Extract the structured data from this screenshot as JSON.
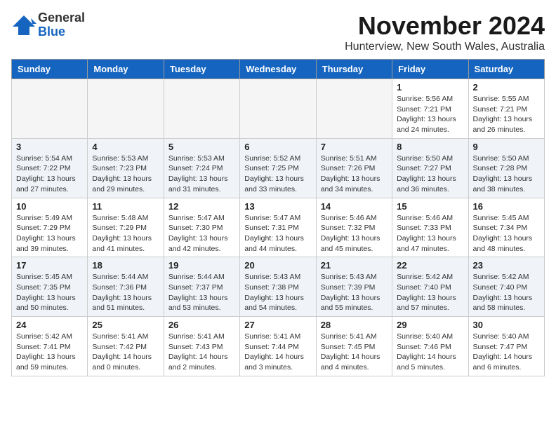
{
  "header": {
    "logo_general": "General",
    "logo_blue": "Blue",
    "month_title": "November 2024",
    "location": "Hunterview, New South Wales, Australia"
  },
  "days_of_week": [
    "Sunday",
    "Monday",
    "Tuesday",
    "Wednesday",
    "Thursday",
    "Friday",
    "Saturday"
  ],
  "weeks": [
    [
      {
        "day": "",
        "info": ""
      },
      {
        "day": "",
        "info": ""
      },
      {
        "day": "",
        "info": ""
      },
      {
        "day": "",
        "info": ""
      },
      {
        "day": "",
        "info": ""
      },
      {
        "day": "1",
        "info": "Sunrise: 5:56 AM\nSunset: 7:21 PM\nDaylight: 13 hours\nand 24 minutes."
      },
      {
        "day": "2",
        "info": "Sunrise: 5:55 AM\nSunset: 7:21 PM\nDaylight: 13 hours\nand 26 minutes."
      }
    ],
    [
      {
        "day": "3",
        "info": "Sunrise: 5:54 AM\nSunset: 7:22 PM\nDaylight: 13 hours\nand 27 minutes."
      },
      {
        "day": "4",
        "info": "Sunrise: 5:53 AM\nSunset: 7:23 PM\nDaylight: 13 hours\nand 29 minutes."
      },
      {
        "day": "5",
        "info": "Sunrise: 5:53 AM\nSunset: 7:24 PM\nDaylight: 13 hours\nand 31 minutes."
      },
      {
        "day": "6",
        "info": "Sunrise: 5:52 AM\nSunset: 7:25 PM\nDaylight: 13 hours\nand 33 minutes."
      },
      {
        "day": "7",
        "info": "Sunrise: 5:51 AM\nSunset: 7:26 PM\nDaylight: 13 hours\nand 34 minutes."
      },
      {
        "day": "8",
        "info": "Sunrise: 5:50 AM\nSunset: 7:27 PM\nDaylight: 13 hours\nand 36 minutes."
      },
      {
        "day": "9",
        "info": "Sunrise: 5:50 AM\nSunset: 7:28 PM\nDaylight: 13 hours\nand 38 minutes."
      }
    ],
    [
      {
        "day": "10",
        "info": "Sunrise: 5:49 AM\nSunset: 7:29 PM\nDaylight: 13 hours\nand 39 minutes."
      },
      {
        "day": "11",
        "info": "Sunrise: 5:48 AM\nSunset: 7:29 PM\nDaylight: 13 hours\nand 41 minutes."
      },
      {
        "day": "12",
        "info": "Sunrise: 5:47 AM\nSunset: 7:30 PM\nDaylight: 13 hours\nand 42 minutes."
      },
      {
        "day": "13",
        "info": "Sunrise: 5:47 AM\nSunset: 7:31 PM\nDaylight: 13 hours\nand 44 minutes."
      },
      {
        "day": "14",
        "info": "Sunrise: 5:46 AM\nSunset: 7:32 PM\nDaylight: 13 hours\nand 45 minutes."
      },
      {
        "day": "15",
        "info": "Sunrise: 5:46 AM\nSunset: 7:33 PM\nDaylight: 13 hours\nand 47 minutes."
      },
      {
        "day": "16",
        "info": "Sunrise: 5:45 AM\nSunset: 7:34 PM\nDaylight: 13 hours\nand 48 minutes."
      }
    ],
    [
      {
        "day": "17",
        "info": "Sunrise: 5:45 AM\nSunset: 7:35 PM\nDaylight: 13 hours\nand 50 minutes."
      },
      {
        "day": "18",
        "info": "Sunrise: 5:44 AM\nSunset: 7:36 PM\nDaylight: 13 hours\nand 51 minutes."
      },
      {
        "day": "19",
        "info": "Sunrise: 5:44 AM\nSunset: 7:37 PM\nDaylight: 13 hours\nand 53 minutes."
      },
      {
        "day": "20",
        "info": "Sunrise: 5:43 AM\nSunset: 7:38 PM\nDaylight: 13 hours\nand 54 minutes."
      },
      {
        "day": "21",
        "info": "Sunrise: 5:43 AM\nSunset: 7:39 PM\nDaylight: 13 hours\nand 55 minutes."
      },
      {
        "day": "22",
        "info": "Sunrise: 5:42 AM\nSunset: 7:40 PM\nDaylight: 13 hours\nand 57 minutes."
      },
      {
        "day": "23",
        "info": "Sunrise: 5:42 AM\nSunset: 7:40 PM\nDaylight: 13 hours\nand 58 minutes."
      }
    ],
    [
      {
        "day": "24",
        "info": "Sunrise: 5:42 AM\nSunset: 7:41 PM\nDaylight: 13 hours\nand 59 minutes."
      },
      {
        "day": "25",
        "info": "Sunrise: 5:41 AM\nSunset: 7:42 PM\nDaylight: 14 hours\nand 0 minutes."
      },
      {
        "day": "26",
        "info": "Sunrise: 5:41 AM\nSunset: 7:43 PM\nDaylight: 14 hours\nand 2 minutes."
      },
      {
        "day": "27",
        "info": "Sunrise: 5:41 AM\nSunset: 7:44 PM\nDaylight: 14 hours\nand 3 minutes."
      },
      {
        "day": "28",
        "info": "Sunrise: 5:41 AM\nSunset: 7:45 PM\nDaylight: 14 hours\nand 4 minutes."
      },
      {
        "day": "29",
        "info": "Sunrise: 5:40 AM\nSunset: 7:46 PM\nDaylight: 14 hours\nand 5 minutes."
      },
      {
        "day": "30",
        "info": "Sunrise: 5:40 AM\nSunset: 7:47 PM\nDaylight: 14 hours\nand 6 minutes."
      }
    ]
  ]
}
